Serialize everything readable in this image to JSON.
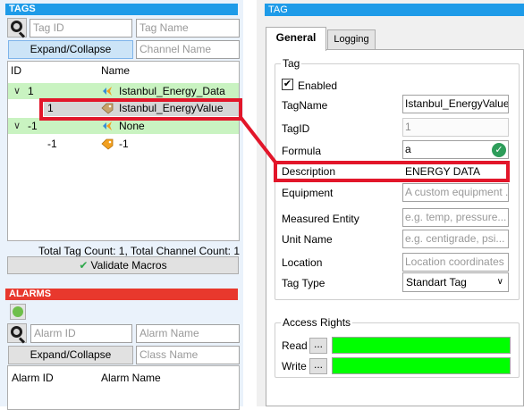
{
  "tags": {
    "header": "TAGS",
    "search": {
      "tag_id_placeholder": "Tag ID",
      "tag_name_placeholder": "Tag Name",
      "channel_name_placeholder": "Channel Name"
    },
    "expand_collapse_label": "Expand/Collapse",
    "tree": {
      "columns": {
        "id": "ID",
        "name": "Name"
      },
      "rows": [
        {
          "id": "1",
          "name": "Istanbul_Energy_Data",
          "type": "channel",
          "expanded": true
        },
        {
          "id": "1",
          "name": "Istanbul_EnergyValue",
          "type": "tag",
          "selected": true
        },
        {
          "id": "-1",
          "name": "None",
          "type": "channel",
          "expanded": true
        },
        {
          "id": "-1",
          "name": "-1",
          "type": "tag"
        }
      ]
    },
    "total_count": "Total Tag Count: 1, Total Channel Count: 1",
    "validate_macros_label": "Validate Macros"
  },
  "alarms": {
    "header": "ALARMS",
    "search": {
      "alarm_id_placeholder": "Alarm ID",
      "alarm_name_placeholder": "Alarm Name",
      "class_name_placeholder": "Class Name"
    },
    "expand_collapse_label": "Expand/Collapse",
    "columns": {
      "alarm_id": "Alarm ID",
      "alarm_name": "Alarm Name"
    }
  },
  "tag_editor": {
    "header": "TAG",
    "tabs": [
      {
        "label": "General",
        "active": true
      },
      {
        "label": "Logging",
        "active": false
      }
    ],
    "tag_group": {
      "title": "Tag",
      "enabled_label": "Enabled",
      "enabled_checked": true,
      "fields": {
        "tagname": {
          "label": "TagName",
          "value": "Istanbul_EnergyValue"
        },
        "tagid": {
          "label": "TagID",
          "value": "1"
        },
        "formula": {
          "label": "Formula",
          "value": "a"
        },
        "description": {
          "label": "Description",
          "value": "ENERGY DATA"
        },
        "equipment": {
          "label": "Equipment",
          "placeholder": "A custom equipment ..."
        },
        "measured_entity": {
          "label": "Measured Entity",
          "placeholder": "e.g. temp, pressure..."
        },
        "unit_name": {
          "label": "Unit Name",
          "placeholder": "e.g. centigrade, psi..."
        },
        "location": {
          "label": "Location",
          "placeholder": "Location coordinates"
        },
        "tag_type": {
          "label": "Tag Type",
          "value": "Standart Tag"
        }
      }
    },
    "access_rights": {
      "title": "Access Rights",
      "read_label": "Read",
      "write_label": "Write",
      "button_label": "...",
      "read_color": "#00ff00",
      "write_color": "#00ff00"
    }
  },
  "colors": {
    "tags_header": "#1e9be8",
    "alarms_header": "#e8382d",
    "highlight_red": "#e2162a",
    "channel_row": "#c9f3c1"
  },
  "icons": {
    "search": "search-icon",
    "channel": "channel-icon",
    "tag": "tag-icon",
    "check": "check-icon",
    "formula_ok": "check-circle-icon",
    "dropdown": "chevron-down-icon"
  }
}
